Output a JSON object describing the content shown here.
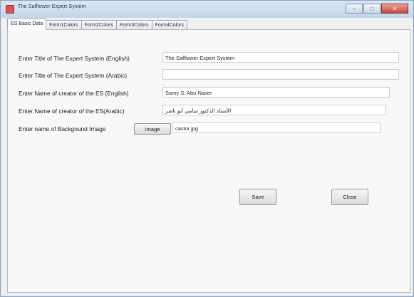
{
  "window": {
    "title": "The Safflower Expert System"
  },
  "tabs": [
    {
      "label": "ES Basic Data"
    },
    {
      "label": "Form1Colors"
    },
    {
      "label": "Form2Colors"
    },
    {
      "label": "Form3Colors"
    },
    {
      "label": "Form4Colors"
    }
  ],
  "form": {
    "title_en_label": "Enter Title of The Expert System (English)",
    "title_en_value": "The Safflower Expert System",
    "title_ar_label": "Enter Title of The Expert System (Arabic)",
    "title_ar_value": "",
    "creator_en_label": "Enter Name of creator of the ES (English)",
    "creator_en_value": "Samy S. Abu Naser",
    "creator_ar_label": "Enter Name of creator of the ES(Arabic)",
    "creator_ar_value": "الأستاذ الدكتور سامي أبو ناصر",
    "bg_label": "Enter name of Backgound Image",
    "image_button": "Image",
    "bg_value": "castor.jpg"
  },
  "actions": {
    "save": "Save",
    "close": "Close"
  },
  "titlebar_buttons": {
    "minimize": "–",
    "maximize": "□",
    "close": "✕"
  }
}
